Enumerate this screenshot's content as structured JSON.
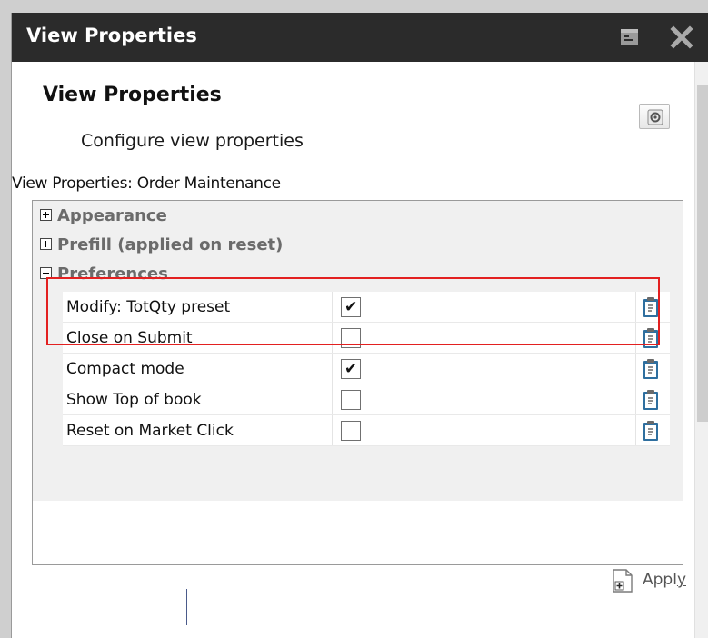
{
  "window": {
    "title": "View Properties"
  },
  "panel": {
    "title": "View Properties",
    "subtitle": "Configure view properties",
    "settings_icon": "gear-icon"
  },
  "view_label": "View Properties: Order Maintenance",
  "sections": [
    {
      "label": "Appearance",
      "expanded": false
    },
    {
      "label": "Prefill (applied on reset)",
      "expanded": false
    },
    {
      "label": "Preferences",
      "expanded": true
    }
  ],
  "preferences": [
    {
      "label": "Modify: TotQty preset",
      "checked": true,
      "checkmark": "✔"
    },
    {
      "label": "Close on Submit",
      "checked": false,
      "checkmark": ""
    },
    {
      "label": "Compact mode",
      "checked": true,
      "checkmark": "✔"
    },
    {
      "label": "Show Top of book",
      "checked": false,
      "checkmark": ""
    },
    {
      "label": "Reset on Market Click",
      "checked": false,
      "checkmark": ""
    }
  ],
  "apply": {
    "label_main": "Appl",
    "label_underlined": "y"
  },
  "colors": {
    "titlebar": "#2b2b2b",
    "highlight": "#e32020"
  }
}
